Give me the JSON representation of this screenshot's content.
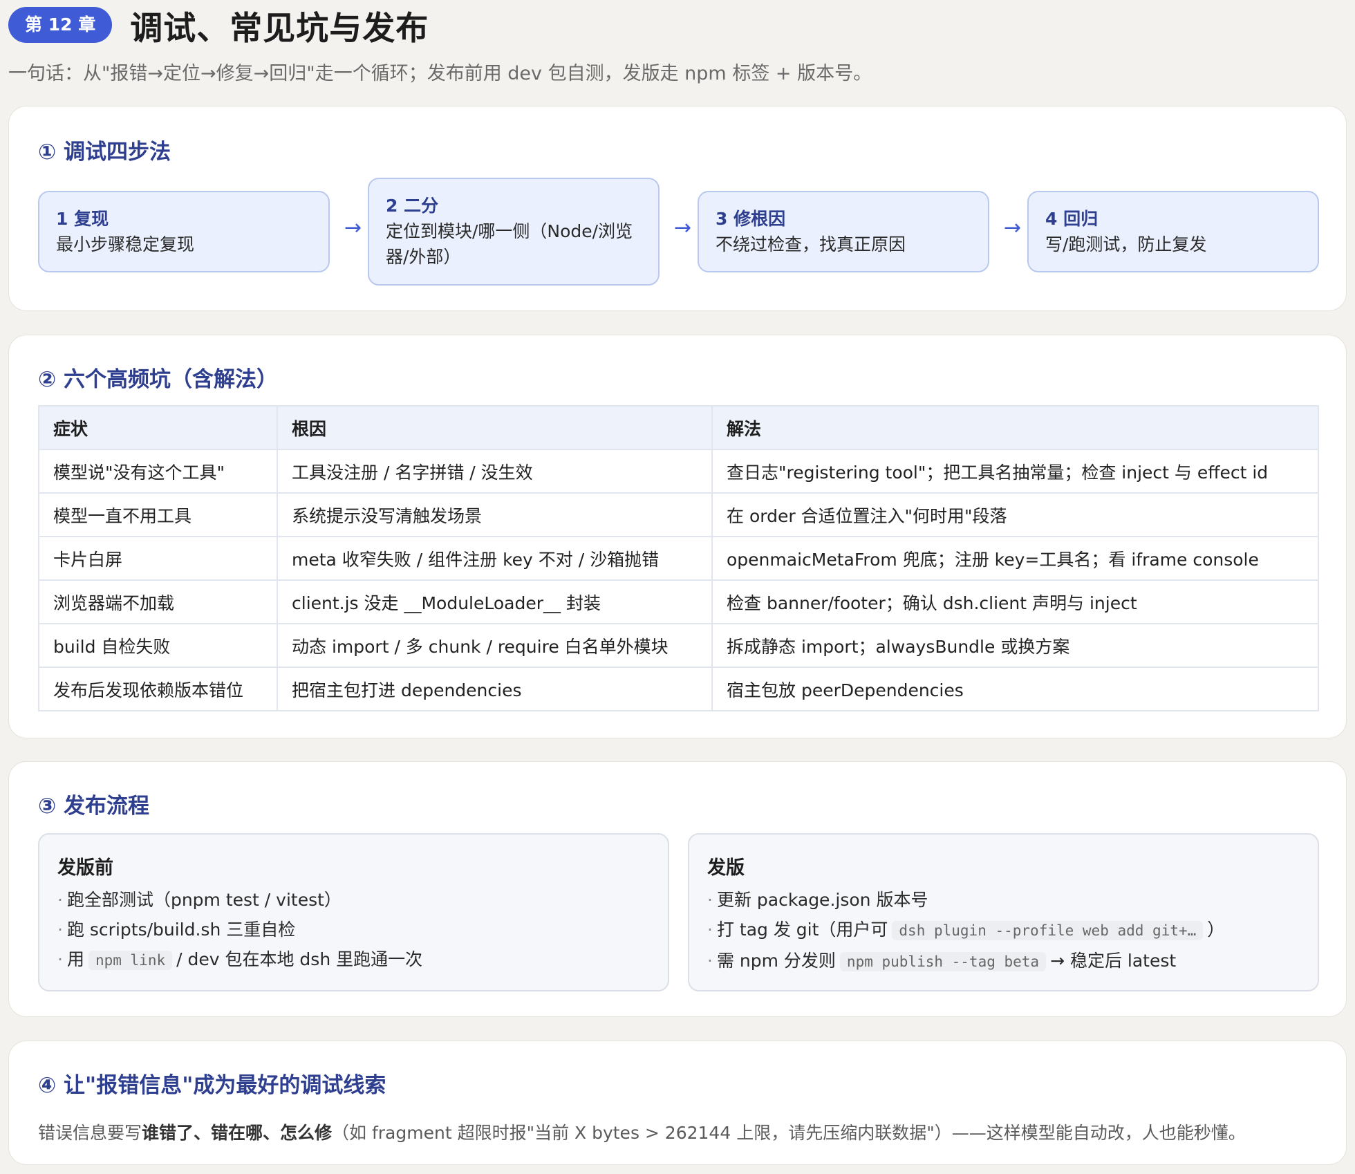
{
  "header": {
    "badge": "第 12 章",
    "title": "调试、常见坑与发布",
    "subtitle": "一句话：从\"报错→定位→修复→回归\"走一个循环；发布前用 dev 包自测，发版走 npm 标签 + 版本号。"
  },
  "debug": {
    "title": "① 调试四步法",
    "arrow": "→",
    "steps": [
      {
        "num": "1 复现",
        "desc": "最小步骤稳定复现"
      },
      {
        "num": "2 二分",
        "desc": "定位到模块/哪一侧（Node/浏览器/外部）"
      },
      {
        "num": "3 修根因",
        "desc": "不绕过检查，找真正原因"
      },
      {
        "num": "4 回归",
        "desc": "写/跑测试，防止复发"
      }
    ]
  },
  "pitfalls": {
    "title": "② 六个高频坑（含解法）",
    "headers": [
      "症状",
      "根因",
      "解法"
    ],
    "rows": [
      [
        "模型说\"没有这个工具\"",
        "工具没注册 / 名字拼错 / 没生效",
        "查日志\"registering tool\"；把工具名抽常量；检查 inject 与 effect id"
      ],
      [
        "模型一直不用工具",
        "系统提示没写清触发场景",
        "在 order 合适位置注入\"何时用\"段落"
      ],
      [
        "卡片白屏",
        "meta 收窄失败 / 组件注册 key 不对 / 沙箱抛错",
        "openmaicMetaFrom 兜底；注册 key=工具名；看 iframe console"
      ],
      [
        "浏览器端不加载",
        "client.js 没走 __ModuleLoader__ 封装",
        "检查 banner/footer；确认 dsh.client 声明与 inject"
      ],
      [
        "build 自检失败",
        "动态 import / 多 chunk / require 白名单外模块",
        "拆成静态 import；alwaysBundle 或换方案"
      ],
      [
        "发布后发现依赖版本错位",
        "把宿主包打进 dependencies",
        "宿主包放 peerDependencies"
      ]
    ]
  },
  "release": {
    "title": "③ 发布流程",
    "before": {
      "title": "发版前",
      "bullet": "·",
      "item1": "跑全部测试（pnpm test / vitest）",
      "item2": "跑 scripts/build.sh 三重自检",
      "item3_pre": "用",
      "item3_code": "npm link",
      "item3_post": "/ dev 包在本地 dsh 里跑通一次"
    },
    "publish": {
      "title": "发版",
      "bullet": "·",
      "item1": "更新 package.json 版本号",
      "item2_pre": "打 tag 发 git（用户可",
      "item2_code": "dsh plugin --profile web add git+…",
      "item2_post": "）",
      "item3_pre": "需 npm 分发则",
      "item3_code": "npm publish --tag beta",
      "item3_post": "→ 稳定后 latest"
    }
  },
  "errors": {
    "title": "④ 让\"报错信息\"成为最好的调试线索",
    "pre": "错误信息要写",
    "bold": "谁错了、错在哪、怎么修",
    "post": "（如 fragment 超限时报\"当前 X bytes > 262144 上限，请先压缩内联数据\"）——这样模型能自动改，人也能秒懂。"
  }
}
